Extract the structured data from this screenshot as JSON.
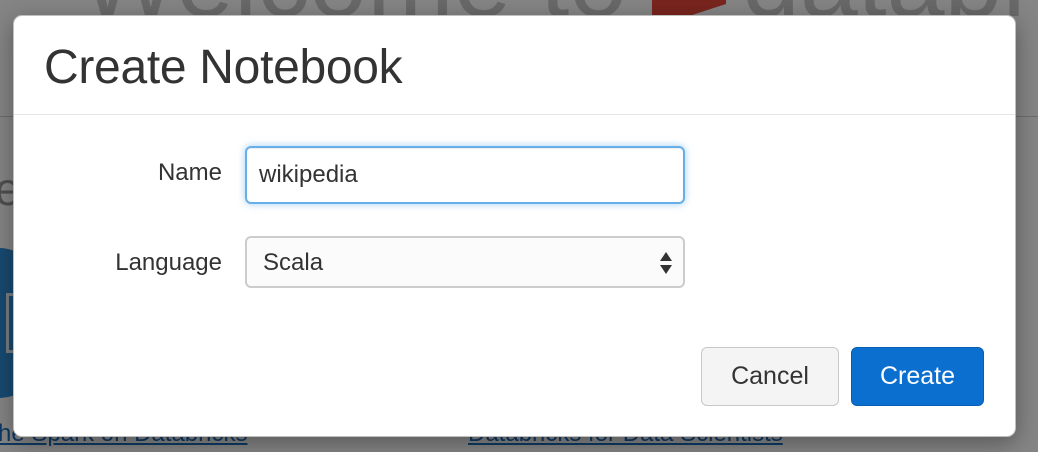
{
  "background": {
    "welcome_text": "Welcome to",
    "brand_text": "databri",
    "section_text": "te",
    "link_left": "che Spark on Databricks",
    "link_right": "Databricks for Data Scientists"
  },
  "modal": {
    "title": "Create Notebook",
    "name_label": "Name",
    "name_value": "wikipedia",
    "language_label": "Language",
    "language_value": "Scala",
    "cancel_label": "Cancel",
    "create_label": "Create"
  },
  "colors": {
    "primary": "#0b6fd0",
    "focus_border": "#66afe9",
    "brand_red": "#e8483a"
  }
}
